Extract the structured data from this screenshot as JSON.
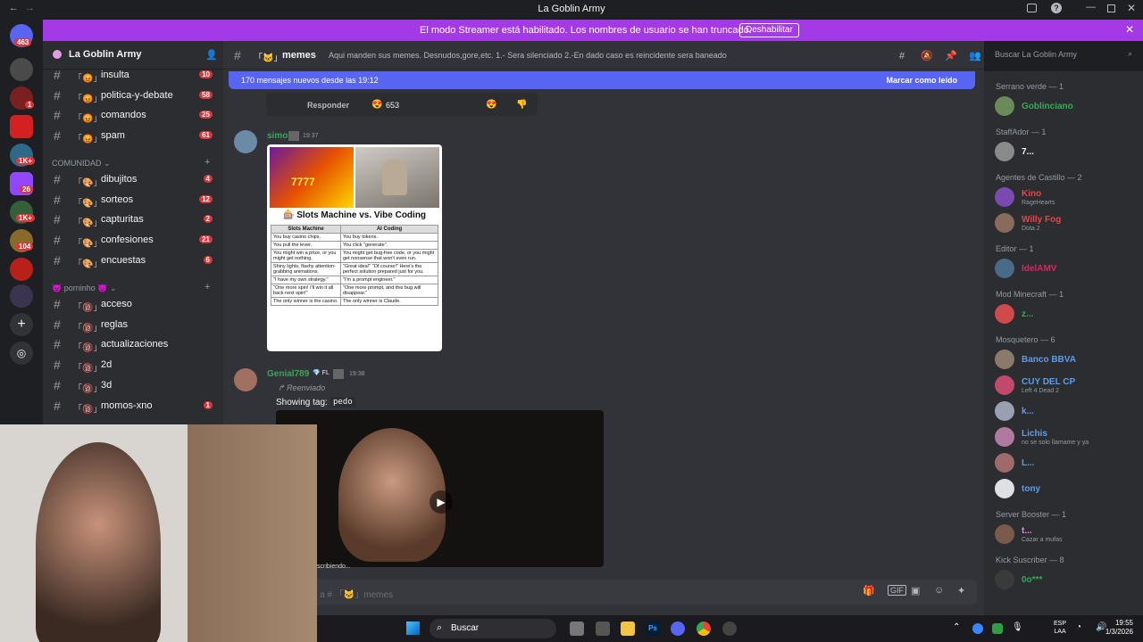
{
  "window": {
    "title": "La Goblin Army"
  },
  "streamer_banner": {
    "text": "El modo Streamer está habilitado. Los nombres de usuario se han truncado.",
    "button": "Deshabilitar"
  },
  "servers": {
    "badges": [
      "463",
      "1",
      "1K+",
      "26",
      "1K+",
      "104"
    ]
  },
  "guild": {
    "name": "La Goblin Army"
  },
  "channels_top": [
    {
      "name": "insulta",
      "count": "10"
    },
    {
      "name": "politica-y-debate",
      "count": "58"
    },
    {
      "name": "comandos",
      "count": "25"
    },
    {
      "name": "spam",
      "count": "61"
    }
  ],
  "category_comunidad": "COMUNIDAD",
  "channels_comunidad": [
    {
      "name": "dibujitos",
      "count": "4"
    },
    {
      "name": "sorteos",
      "count": "12"
    },
    {
      "name": "capturitas",
      "count": "2"
    },
    {
      "name": "confesiones",
      "count": "21"
    },
    {
      "name": "encuestas",
      "count": "6"
    }
  ],
  "category_porninho": "porninho",
  "channels_porninho": [
    {
      "name": "acceso",
      "count": ""
    },
    {
      "name": "reglas",
      "count": ""
    },
    {
      "name": "actualizaciones",
      "count": ""
    },
    {
      "name": "2d",
      "count": ""
    },
    {
      "name": "3d",
      "count": ""
    },
    {
      "name": "momos-xno",
      "count": "1"
    }
  ],
  "channel": {
    "name": "memes",
    "topic": "Aqui manden sus memes. Desnudos,gore,etc. 1.- Sera silenciado 2.-En dado caso es reincidente sera baneado"
  },
  "new_messages": {
    "text": "170 mensajes nuevos desde las 19:12",
    "mark_read": "Marcar como leído"
  },
  "prev_message": {
    "reply": "Responder",
    "reaction_count": "653"
  },
  "msg1": {
    "author": "simo",
    "time": "19:37"
  },
  "meme": {
    "title": "Slots Machine vs. Vibe Coding",
    "headers": [
      "Slots Machine",
      "AI Coding"
    ],
    "rows": [
      [
        "You buy casino chips.",
        "You buy tokens."
      ],
      [
        "You pull the lever.",
        "You click \"generate\"."
      ],
      [
        "You might win a prize, or you might get nothing.",
        "You might get bug-free code, or you might get nonsense that won't even run."
      ],
      [
        "Shiny lights, flashy attention-grabbing animations.",
        "\"Great idea!\" \"Of course!\" Here's the perfect solution prepared just for you."
      ],
      [
        "\"I have my own strategy.\"",
        "\"I'm a prompt engineer.\""
      ],
      [
        "\"One more spin! I'll win it all back next spin!\"",
        "\"One more prompt, and this bug will disappear.\""
      ],
      [
        "The only winner is the casino.",
        "The only winner is Claude."
      ]
    ]
  },
  "msg2": {
    "author": "Genial789",
    "tag": "FL",
    "time": "19:38",
    "forwarded": "Reenviado",
    "showing": "Showing tag:",
    "tag_value": "pedo"
  },
  "typing": "scribiendo...",
  "composer": {
    "placeholder": "aje a # 「🐱」memes"
  },
  "search": {
    "placeholder": "Buscar La Goblin Army"
  },
  "members": [
    {
      "header": "Serrano verde — 1",
      "users": [
        {
          "name": "Goblinciano",
          "status": "",
          "color": "#3ba55c"
        }
      ]
    },
    {
      "header": "StaffAdor — 1",
      "users": [
        {
          "name": "7...",
          "status": "",
          "color": "#f2f3f5"
        }
      ]
    },
    {
      "header": "Agentes de Castillo — 2",
      "users": [
        {
          "name": "Kino",
          "status": "RageHearts",
          "color": "#ed4245"
        },
        {
          "name": "Willy Fog",
          "status": "Dota 2",
          "color": "#ed4245"
        }
      ]
    },
    {
      "header": "Editor — 1",
      "users": [
        {
          "name": "IdelAMV",
          "status": "",
          "color": "#e91e63"
        }
      ]
    },
    {
      "header": "Mod Minecraft — 1",
      "users": [
        {
          "name": "z...",
          "status": "",
          "color": "#3ba55c"
        }
      ]
    },
    {
      "header": "Mosquetero — 6",
      "users": [
        {
          "name": "Banco BBVA",
          "status": "",
          "color": "#5d9cec"
        },
        {
          "name": "CUY DEL CP",
          "status": "Left 4 Dead 2",
          "color": "#5d9cec"
        },
        {
          "name": "k...",
          "status": "",
          "color": "#5d9cec"
        },
        {
          "name": "Lichis",
          "status": "no se solo llamame y ya",
          "color": "#5d9cec"
        },
        {
          "name": "L...",
          "status": "",
          "color": "#5d9cec"
        },
        {
          "name": "tony",
          "status": "",
          "color": "#5d9cec"
        }
      ]
    },
    {
      "header": "Server Booster — 1",
      "users": [
        {
          "name": "t...",
          "status": "Cazar a mufas",
          "color": "#f47fff"
        }
      ]
    },
    {
      "header": "Kick Suscriber — 8",
      "users": [
        {
          "name": "0o***",
          "status": "",
          "color": "#3ba55c"
        }
      ]
    }
  ],
  "member_tags": {
    "cuy": "SDLG",
    "lichis": "RIOT",
    "tony": "UMA"
  },
  "taskbar": {
    "search": "Buscar",
    "lang": "ESP",
    "lang2": "LAA",
    "time": "19:55",
    "date": "1/3/2026"
  }
}
